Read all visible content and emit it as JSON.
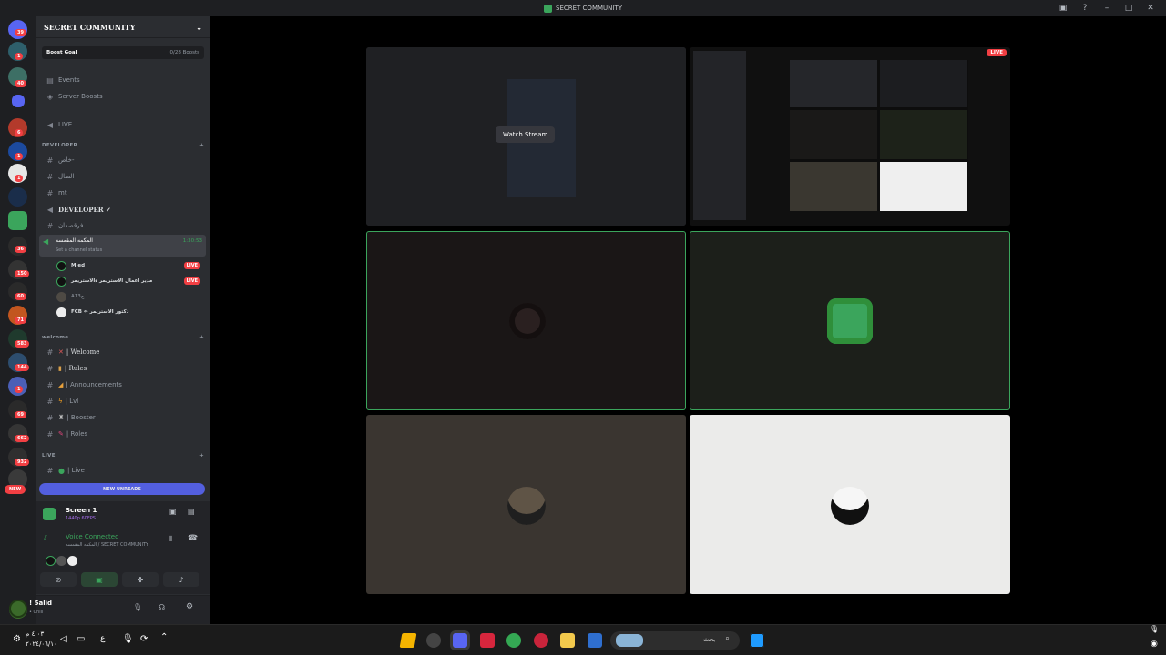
{
  "window": {
    "title": "SECRET COMMUNITY"
  },
  "guild_badges": [
    "39",
    "1",
    "40",
    "6",
    "1",
    "1",
    "36",
    "150",
    "60",
    "71",
    "583",
    "144",
    "1",
    "69",
    "662",
    "932"
  ],
  "guild_new": "NEW",
  "server": {
    "name": "SECRET COMMUNITY",
    "boost_goal": "Boost Goal",
    "boost_count": "0/28 Boosts",
    "events": "Events",
    "server_boosts": "Server Boosts",
    "live_channel": "LIVE",
    "categories": {
      "developer": "DEVELOPER",
      "welcome": "welcome",
      "live": "LIVE"
    },
    "dev_channels": [
      "خاص-",
      "الصال",
      "mt"
    ],
    "dev_voice": "DEVELOPER ✓",
    "dev_text2": "فرقصدان",
    "active_vc": {
      "name": "المكمه المقمسه",
      "status": "Set a channel status",
      "timer": "1:30:53"
    },
    "vc_users": [
      {
        "name": "Mjed",
        "live": "LIVE"
      },
      {
        "name": "مدير اعمال الاستريمر ءالاستريمر",
        "live": "LIVE"
      },
      {
        "name": "A13ح"
      },
      {
        "name": "FCB ⇔ دكتور الاستريمر"
      }
    ],
    "welcome_channels": [
      "| Welcome",
      "| Rules",
      "| Announcements",
      "| Lvl",
      "| Booster",
      "| Roles"
    ],
    "live_channels": [
      "| Live"
    ],
    "new_unreads": "NEW UNREADS"
  },
  "rtc": {
    "screen_title": "Screen 1",
    "screen_sub": "1440p 60FPS",
    "voice_connected": "Voice Connected",
    "voice_path": "المكمه المقمسه / SECRET COMMUNITY"
  },
  "user": {
    "name": "! 5alid",
    "status": "• Chill"
  },
  "stage": {
    "watch_stream": "Watch Stream",
    "live_badge": "LIVE"
  },
  "taskbar": {
    "time": "٤:٠٣ م",
    "date": "٢٠٢٤/٠٦/١٠",
    "lang": "ع",
    "search_placeholder": "بحث"
  },
  "colors": {
    "green": "#3ba55c",
    "red": "#f23f43",
    "blurple": "#5865f2"
  }
}
